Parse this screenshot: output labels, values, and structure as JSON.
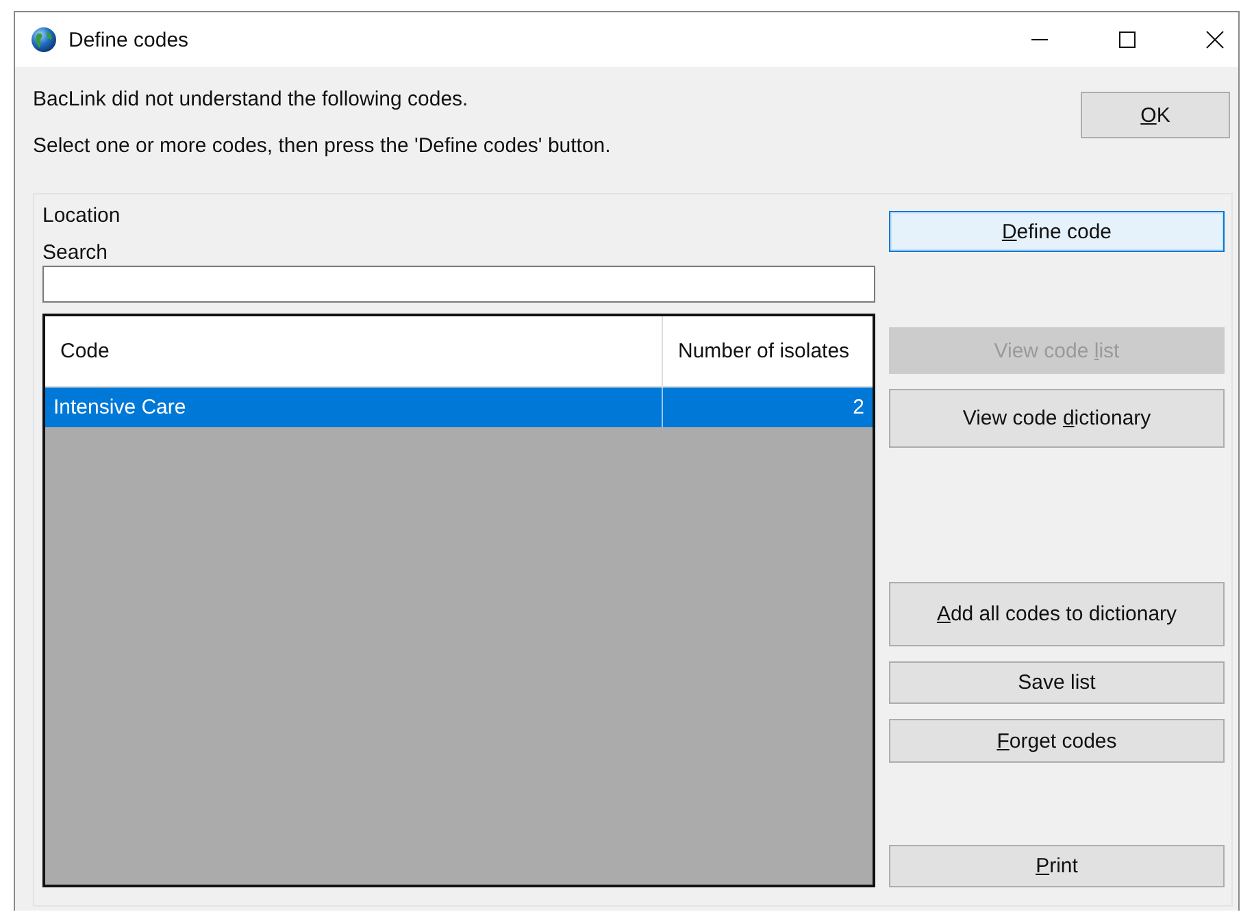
{
  "window": {
    "title": "Define codes"
  },
  "messages": [
    "BacLink did not understand the following codes.",
    "Select one or more codes, then press the 'Define codes' button."
  ],
  "ok_button": {
    "key": "O",
    "post": "K",
    "disabled": false,
    "focused": false
  },
  "field_label": "Location",
  "search": {
    "label": "Search"
  },
  "table": {
    "columns": [
      "Code",
      "Number of isolates"
    ],
    "rows": [
      {
        "cells": [
          "Intensive Care",
          "2"
        ],
        "selected": true
      }
    ]
  },
  "buttons": [
    {
      "key": "D",
      "post": "efine code",
      "disabled": false,
      "focused": true
    },
    {
      "pre": "View code ",
      "key": "l",
      "post": "ist",
      "disabled": true,
      "focused": false
    },
    {
      "pre": "View code ",
      "key": "d",
      "post": "ictionary",
      "disabled": false,
      "focused": false
    },
    {
      "key": "A",
      "post": "dd all codes to dictionary",
      "disabled": false,
      "focused": false
    },
    {
      "pre": "Save list",
      "disabled": false,
      "focused": false
    },
    {
      "key": "F",
      "post": "orget codes",
      "disabled": false,
      "focused": false
    },
    {
      "key": "P",
      "post": "rint",
      "disabled": false,
      "focused": false
    }
  ]
}
